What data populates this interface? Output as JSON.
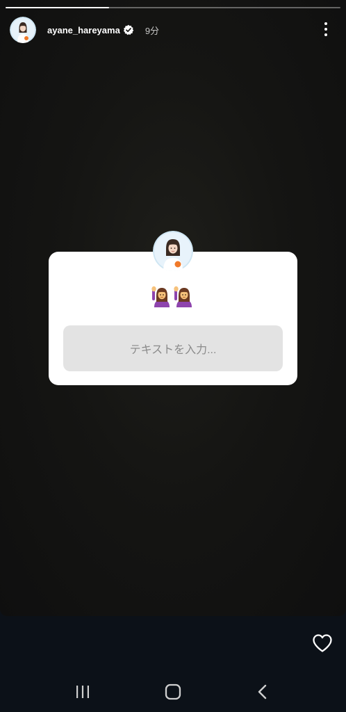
{
  "story": {
    "progress_fraction": 0.31,
    "username": "ayane_hareyama",
    "verified": true,
    "time_ago": "9分",
    "menu_icon": "more-vertical-icon"
  },
  "question_card": {
    "emoji": [
      "🙋‍♀️",
      "🙋‍♀️"
    ],
    "input_placeholder": "テキストを入力..."
  },
  "actions": {
    "like_icon": "heart-outline-icon"
  },
  "system_nav": {
    "recents_icon": "recent-apps-icon",
    "home_icon": "home-icon",
    "back_icon": "back-icon"
  },
  "colors": {
    "accent_white": "#ffffff",
    "bottom_bar": "#0c1118",
    "input_bg": "#e3e3e3",
    "verified_badge": "#ffffff"
  }
}
